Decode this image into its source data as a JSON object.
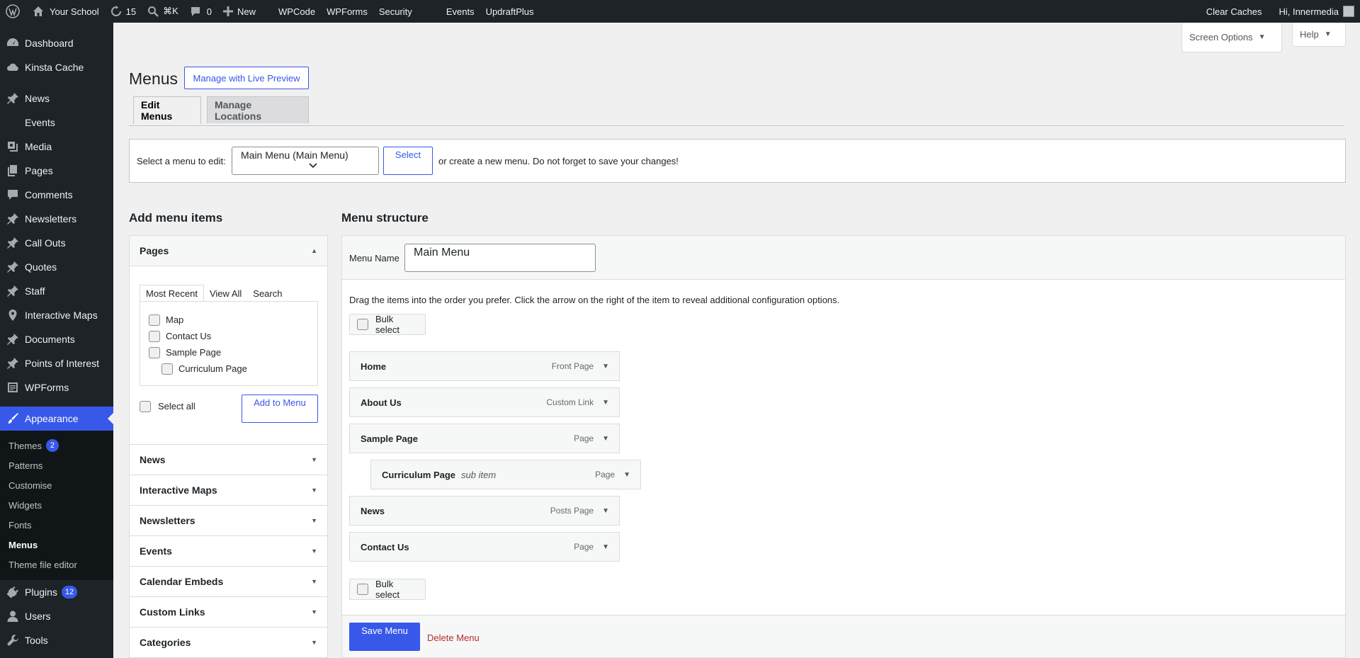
{
  "adminbar": {
    "site_name": "Your School",
    "updates_count": "15",
    "shortcut": "⌘K",
    "comments_count": "0",
    "new_label": "New",
    "links": [
      "WPCode",
      "WPForms",
      "Security",
      "Events",
      "UpdraftPlus"
    ],
    "clear_caches": "Clear Caches",
    "greeting": "Hi, Innermedia"
  },
  "sidebar": {
    "items": [
      {
        "label": "Dashboard",
        "icon": "dashboard-icon"
      },
      {
        "label": "Kinsta Cache",
        "icon": "cloud-icon"
      },
      {
        "label": "News",
        "icon": "pin-icon"
      },
      {
        "label": "Events",
        "icon": "none"
      },
      {
        "label": "Media",
        "icon": "media-icon"
      },
      {
        "label": "Pages",
        "icon": "pages-icon"
      },
      {
        "label": "Comments",
        "icon": "comment-icon"
      },
      {
        "label": "Newsletters",
        "icon": "pin-icon"
      },
      {
        "label": "Call Outs",
        "icon": "pin-icon"
      },
      {
        "label": "Quotes",
        "icon": "pin-icon"
      },
      {
        "label": "Staff",
        "icon": "pin-icon"
      },
      {
        "label": "Interactive Maps",
        "icon": "location-icon"
      },
      {
        "label": "Documents",
        "icon": "pin-icon"
      },
      {
        "label": "Points of Interest",
        "icon": "pin-icon"
      },
      {
        "label": "WPForms",
        "icon": "forms-icon"
      }
    ],
    "appearance": "Appearance",
    "submenu": [
      {
        "label": "Themes",
        "badge": "2"
      },
      {
        "label": "Patterns"
      },
      {
        "label": "Customise"
      },
      {
        "label": "Widgets"
      },
      {
        "label": "Fonts"
      },
      {
        "label": "Menus"
      },
      {
        "label": "Theme file editor"
      }
    ],
    "bottom_items": [
      {
        "label": "Plugins",
        "badge": "12"
      },
      {
        "label": "Users"
      },
      {
        "label": "Tools"
      }
    ]
  },
  "screen_options": "Screen Options",
  "help": "Help",
  "page": {
    "title": "Menus",
    "live_preview": "Manage with Live Preview",
    "tabs": [
      "Edit Menus",
      "Manage Locations"
    ],
    "select_label": "Select a menu to edit:",
    "select_value": "Main Menu (Main Menu)",
    "select_button": "Select",
    "create_note": "or create a new menu. Do not forget to save your changes!"
  },
  "add_items": {
    "heading": "Add menu items",
    "pages_heading": "Pages",
    "inner_tabs": [
      "Most Recent",
      "View All",
      "Search"
    ],
    "pages": [
      "Map",
      "Contact Us",
      "Sample Page",
      "Curriculum Page"
    ],
    "select_all": "Select all",
    "add_button": "Add to Menu",
    "sections": [
      "News",
      "Interactive Maps",
      "Newsletters",
      "Events",
      "Calendar Embeds",
      "Custom Links",
      "Categories"
    ]
  },
  "structure": {
    "heading": "Menu structure",
    "name_label": "Menu Name",
    "name_value": "Main Menu",
    "instructions": "Drag the items into the order you prefer. Click the arrow on the right of the item to reveal additional configuration options.",
    "bulk_select": "Bulk select",
    "items": [
      {
        "title": "Home",
        "type": "Front Page"
      },
      {
        "title": "About Us",
        "type": "Custom Link"
      },
      {
        "title": "Sample Page",
        "type": "Page"
      },
      {
        "title": "Curriculum Page",
        "sub": "sub item",
        "type": "Page"
      },
      {
        "title": "News",
        "type": "Posts Page"
      },
      {
        "title": "Contact Us",
        "type": "Page"
      }
    ],
    "save": "Save Menu",
    "delete": "Delete Menu"
  },
  "colors": {
    "accent": "#3858e9",
    "adminbar": "#1d2327",
    "delete": "#b32d2e"
  }
}
